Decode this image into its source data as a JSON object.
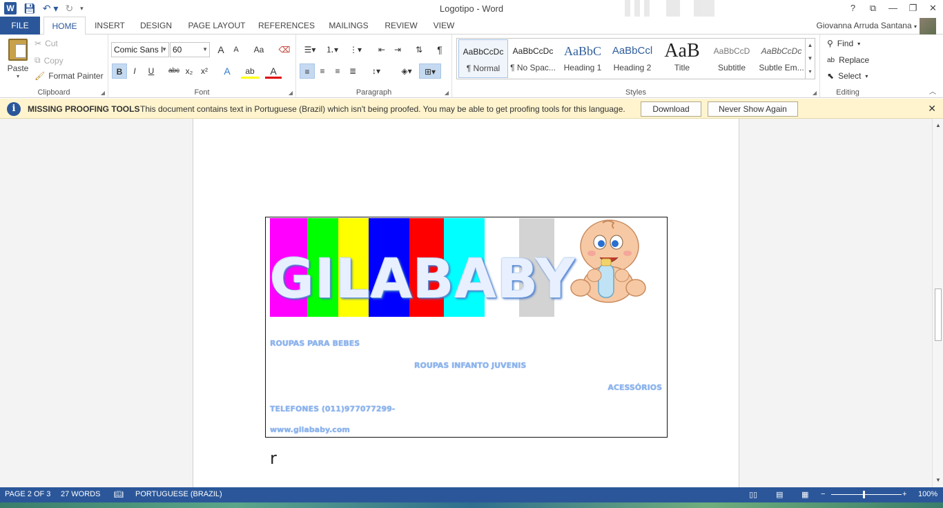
{
  "window": {
    "title": "Logotipo - Word",
    "controls": [
      "?",
      "⧉",
      "—",
      "❐",
      "✕"
    ]
  },
  "qat": {
    "save_icon": "save-icon",
    "undo_icon": "undo-icon",
    "redo_icon": "redo-icon"
  },
  "tabs": [
    "FILE",
    "HOME",
    "INSERT",
    "DESIGN",
    "PAGE LAYOUT",
    "REFERENCES",
    "MAILINGS",
    "REVIEW",
    "VIEW"
  ],
  "user": {
    "name": "Giovanna Arruda Santana"
  },
  "clipboard": {
    "paste": "Paste",
    "cut": "Cut",
    "copy": "Copy",
    "format_painter": "Format Painter",
    "label": "Clipboard"
  },
  "font": {
    "family": "Comic Sans I",
    "size": "60",
    "label": "Font",
    "buttons": {
      "grow": "A",
      "shrink": "A",
      "case": "Aa",
      "bold": "B",
      "italic": "I",
      "underline": "U",
      "strike": "abc",
      "sub": "x₂",
      "sup": "x²",
      "effects": "A",
      "highlight": "ab",
      "color": "A"
    }
  },
  "paragraph": {
    "label": "Paragraph",
    "pilcrow": "¶"
  },
  "styles": {
    "label": "Styles",
    "items": [
      {
        "sample": "AaBbCcDc",
        "name": "¶ Normal"
      },
      {
        "sample": "AaBbCcDc",
        "name": "¶ No Spac..."
      },
      {
        "sample": "AaBbC",
        "name": "Heading 1"
      },
      {
        "sample": "AaBbCcl",
        "name": "Heading 2"
      },
      {
        "sample": "AaB",
        "name": "Title"
      },
      {
        "sample": "AaBbCcD",
        "name": "Subtitle"
      },
      {
        "sample": "AaBbCcDc",
        "name": "Subtle Em..."
      }
    ]
  },
  "editing": {
    "label": "Editing",
    "find": "Find",
    "replace": "Replace",
    "select": "Select"
  },
  "message_bar": {
    "title": "MISSING PROOFING TOOLS",
    "text": "This document contains text in Portuguese (Brazil) which isn't being proofed. You may be able to get proofing tools for this language.",
    "download": "Download",
    "never_show": "Never Show Again"
  },
  "document": {
    "logo_letters": "GILABABY",
    "stripe_colors": [
      "#ff00ff",
      "#00ff00",
      "#ffff00",
      "#0000ff",
      "#ff0000",
      "#00ffff",
      "#ffffff",
      "#d3d3d3"
    ],
    "line1": "ROUPAS PARA BEBES",
    "line2": "ROUPAS INFANTO JUVENIS",
    "line3": "ACESSÓRIOS",
    "line4": "TELEFONES (011)977077299-",
    "line5": "www.gilababy.com",
    "trailing_text": "r"
  },
  "status": {
    "page": "PAGE 2 OF 3",
    "words": "27 WORDS",
    "language": "PORTUGUESE (BRAZIL)",
    "zoom": "100%",
    "zoom_minus": "−",
    "zoom_plus": "+"
  }
}
